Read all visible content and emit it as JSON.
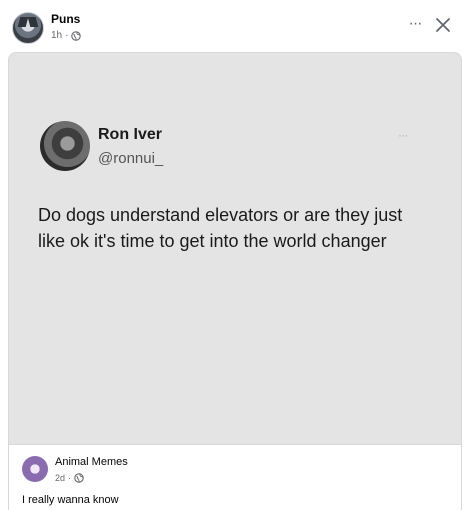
{
  "post": {
    "page_name": "Puns",
    "time": "1h",
    "separator": "·",
    "more_label": "···",
    "privacy_icon": "globe-icon",
    "close_icon": "close-icon"
  },
  "tweet": {
    "name": "Ron Iver",
    "handle": "@ronnui_",
    "more_label": "···",
    "text": "Do dogs understand elevators or are they just like ok it's time to get into the world changer"
  },
  "shared": {
    "page_name": "Animal Memes",
    "time": "2d",
    "separator": "·",
    "privacy_icon": "globe-icon",
    "text": "I really wanna know"
  },
  "colors": {
    "card_bg": "#e4e4e4",
    "meta_gray": "#65676b"
  }
}
